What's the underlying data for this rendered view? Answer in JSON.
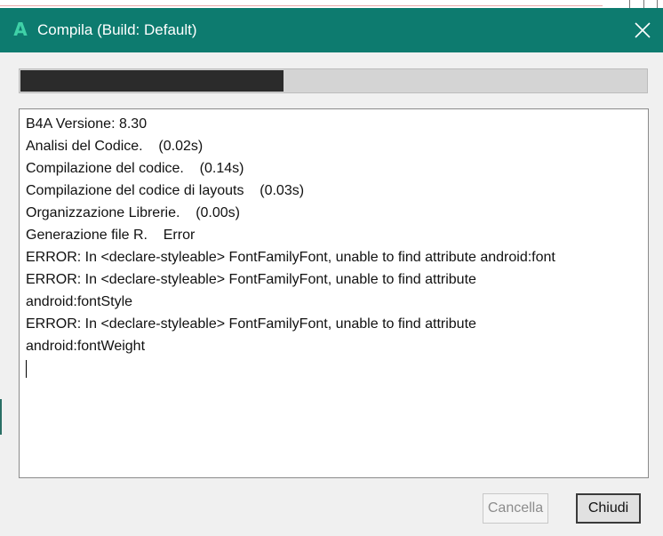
{
  "window": {
    "title": "Compila (Build: Default)",
    "app_icon_glyph": "A",
    "app_icon_name": "b4a-app-icon",
    "titlebar_color": "#0d7b6f",
    "close_icon": "close-icon"
  },
  "progress": {
    "fraction": 0.42
  },
  "log": {
    "lines": [
      "B4A Versione: 8.30",
      "Analisi del Codice.    (0.02s)",
      "Compilazione del codice.    (0.14s)",
      "Compilazione del codice di layouts    (0.03s)",
      "Organizzazione Librerie.    (0.00s)",
      "Generazione file R.    Error",
      "ERROR: In <declare-styleable> FontFamilyFont, unable to find attribute android:font",
      "ERROR: In <declare-styleable> FontFamilyFont, unable to find attribute",
      "android:fontStyle",
      "ERROR: In <declare-styleable> FontFamilyFont, unable to find attribute",
      "android:fontWeight"
    ]
  },
  "buttons": {
    "cancel_label": "Cancella",
    "close_label": "Chiudi"
  }
}
